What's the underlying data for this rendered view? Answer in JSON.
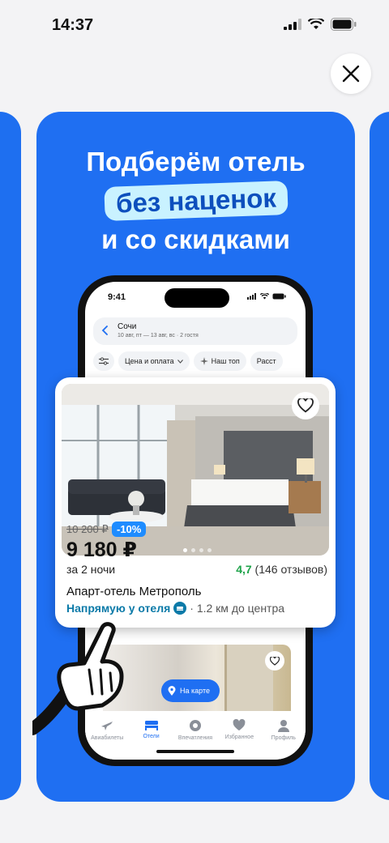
{
  "status_bar": {
    "time": "14:37"
  },
  "headline": {
    "line1": "Подберём отель",
    "highlight": "без наценок",
    "line3": "и со скидками"
  },
  "phone": {
    "time": "9:41",
    "search": {
      "city": "Сочи",
      "dates": "10 авг, пт — 13 авг, вс · 2 гостя"
    },
    "filters": [
      "Цена и оплата",
      "Наш топ",
      "Расст"
    ],
    "map_button": "На карте",
    "tabs": [
      {
        "label": "Авиабилеты",
        "icon": "plane-icon"
      },
      {
        "label": "Отели",
        "icon": "bed-icon",
        "active": true
      },
      {
        "label": "Впечатления",
        "icon": "pin-icon"
      },
      {
        "label": "Избранное",
        "icon": "heart-icon"
      },
      {
        "label": "Профиль",
        "icon": "person-icon"
      }
    ]
  },
  "hotel_card": {
    "old_price": "10 200 ₽",
    "discount": "-10%",
    "price": "9 180 ₽",
    "nights": "за 2 ночи",
    "rating": "4,7",
    "reviews": "(146 отзывов)",
    "name": "Апарт-отель Метрополь",
    "direct": "Напрямую у отеля",
    "distance": "· 1.2 км до центра"
  },
  "colors": {
    "brand_blue": "#1f6ff2",
    "highlight_bg": "#c9f2ff",
    "rating_green": "#1ea34a"
  }
}
